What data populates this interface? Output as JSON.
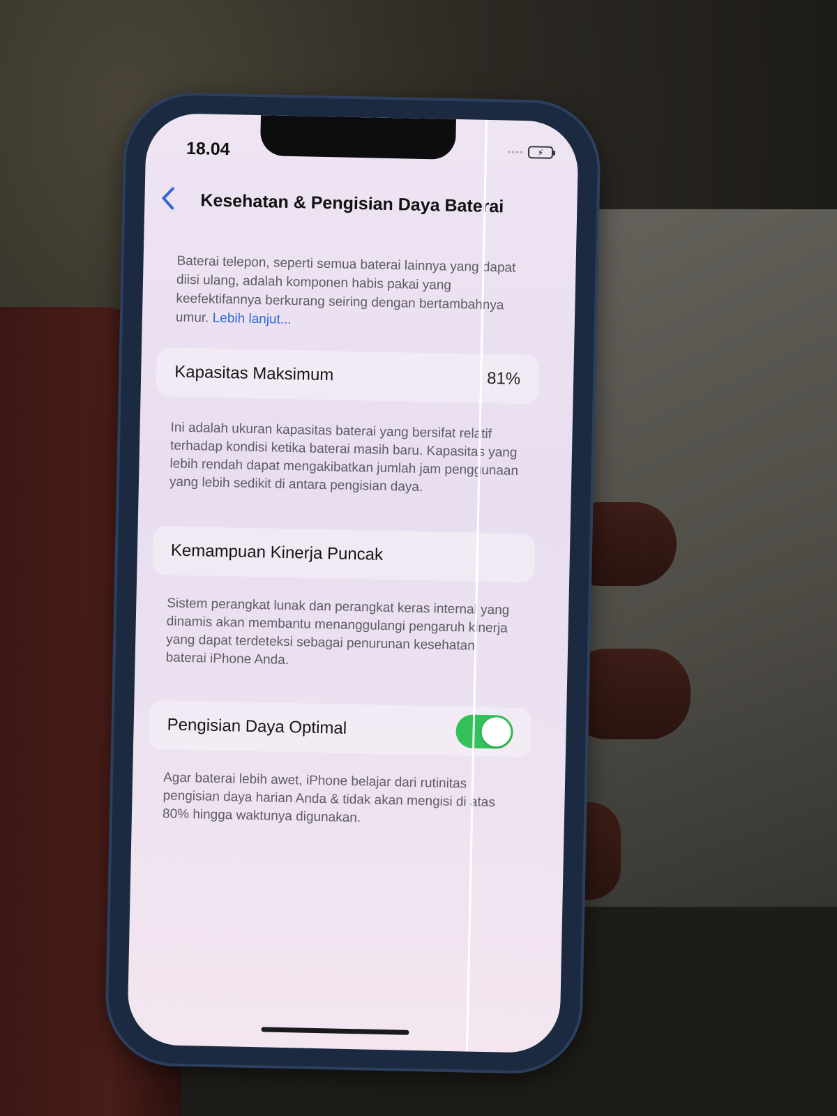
{
  "status_bar": {
    "time": "18.04",
    "battery_icon": "battery-charging-icon"
  },
  "nav": {
    "back_icon": "chevron-left-icon",
    "title": "Kesehatan & Pengisian Daya Baterai"
  },
  "intro": {
    "text": "Baterai telepon, seperti semua baterai lainnya yang dapat diisi ulang, adalah komponen habis pakai yang keefektifannya berkurang seiring dengan bertambahnya umur. ",
    "link": "Lebih lanjut..."
  },
  "max_capacity": {
    "label": "Kapasitas Maksimum",
    "value": "81%",
    "description": "Ini adalah ukuran kapasitas baterai yang bersifat relatif terhadap kondisi ketika baterai masih baru. Kapasitas yang lebih rendah dapat mengakibatkan jumlah jam penggunaan yang lebih sedikit di antara pengisian daya."
  },
  "peak_performance": {
    "label": "Kemampuan Kinerja Puncak",
    "description": "Sistem perangkat lunak dan perangkat keras internal yang dinamis akan membantu menanggulangi pengaruh kinerja yang dapat terdeteksi sebagai penurunan kesehatan baterai iPhone Anda."
  },
  "optimized_charging": {
    "label": "Pengisian Daya Optimal",
    "enabled": true,
    "toggle_color": "#33c15a",
    "description": "Agar baterai lebih awet, iPhone belajar dari rutinitas pengisian daya harian Anda & tidak akan mengisi di atas 80% hingga waktunya digunakan."
  }
}
